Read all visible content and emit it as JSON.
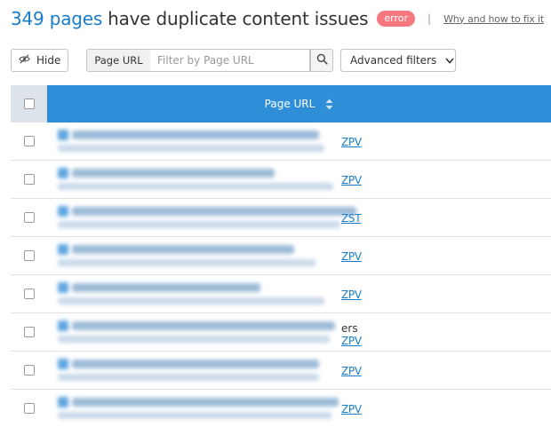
{
  "header": {
    "count": "349 pages",
    "title_rest": "have duplicate content issues",
    "badge": "error",
    "separator": "|",
    "why_link": "Why and how to fix it"
  },
  "toolbar": {
    "hide_label": "Hide",
    "page_url_label": "Page URL",
    "filter_placeholder": "Filter by Page URL",
    "filter_value": "",
    "advanced_filters_label": "Advanced filters",
    "icons": {
      "hide": "eye-slash-icon",
      "search": "search-icon",
      "advanced": "chevron-down-icon"
    }
  },
  "table": {
    "column_header": "Page URL",
    "header_bg": "#2e8fd8",
    "rows": [
      {
        "url_visible_tail": "ZPV",
        "extra": ""
      },
      {
        "url_visible_tail": "ZPV",
        "extra": ""
      },
      {
        "url_visible_tail": "ZST",
        "extra": ""
      },
      {
        "url_visible_tail": "ZPV",
        "extra": ""
      },
      {
        "url_visible_tail": "ZPV",
        "extra": ""
      },
      {
        "url_visible_tail": "ZPV",
        "extra": "ers"
      },
      {
        "url_visible_tail": "ZPV",
        "extra": ""
      },
      {
        "url_visible_tail": "ZPV",
        "extra": ""
      }
    ]
  },
  "colors": {
    "accent": "#1a7dc9",
    "badge": "#f5787f",
    "header_checkbox_bg": "#dde3ea"
  }
}
